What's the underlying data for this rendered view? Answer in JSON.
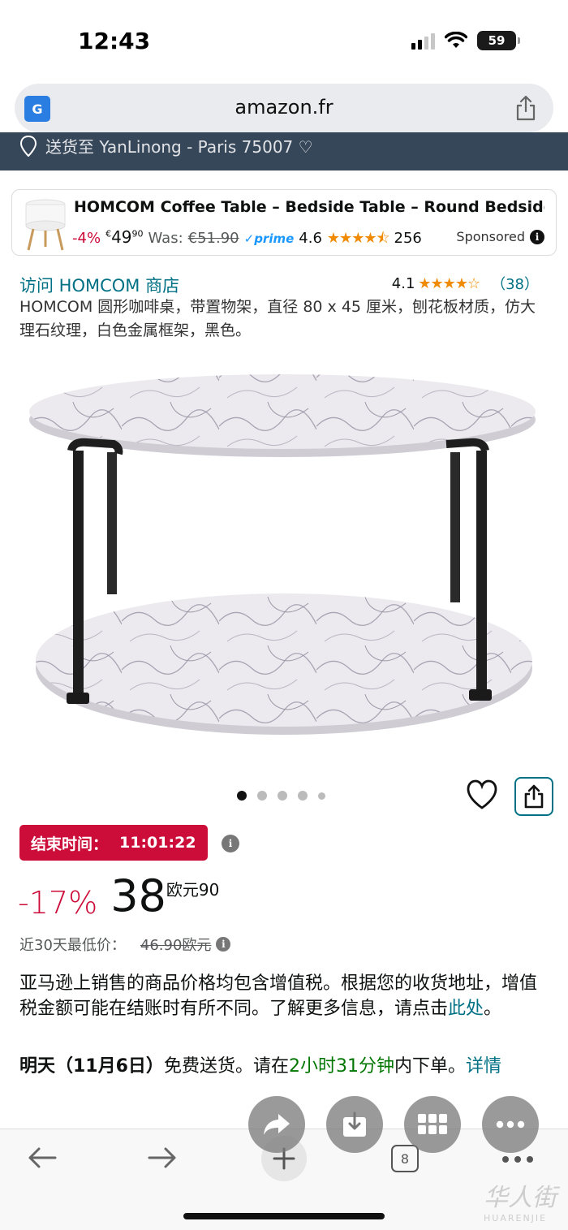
{
  "status_bar": {
    "time": "12:43",
    "battery": "59"
  },
  "browser": {
    "url": "amazon.fr"
  },
  "deliver_strip": {
    "text": "送货至 YanLinong - Paris 75007 ♡"
  },
  "sponsored_ad": {
    "title": "HOMCOM Coffee Table – Bedside Table – Round Bedside Table –...",
    "discount": "-4%",
    "price_currency": "€",
    "price_int": "49",
    "price_dec": "90",
    "was_label": "Was:",
    "was_price": "€51.90",
    "prime": "✓prime",
    "rating": "4.6",
    "stars": "★★★★⯪",
    "reviews": "256",
    "sponsored_label": "Sponsored"
  },
  "product": {
    "store_link": "访问 HOMCOM 商店",
    "rating": "4.1",
    "stars": "★★★★☆",
    "rating_count": "（38）",
    "title": "HOMCOM 圆形咖啡桌，带置物架，直径 80 x 45 厘米，刨花板材质，仿大理石纹理，白色金属框架，黑色。"
  },
  "deal": {
    "label": "结束时间：",
    "timer": "11:01:22"
  },
  "price": {
    "discount": "-17%",
    "integer": "38",
    "decimal": "欧元90",
    "lowest_label": "近30天最低价：",
    "lowest_price": "46.90欧元"
  },
  "vat": {
    "text": "亚马逊上销售的商品价格均包含增值税。根据您的收货地址，增值税金额可能在结账时有所不同。了解更多信息，请点击",
    "link": "此处",
    "end": "。"
  },
  "delivery": {
    "bold": "明天（11月6日）",
    "text1": "免费送货。请在",
    "green": "2小时31分钟",
    "text2": "内下单。",
    "link": "详情"
  },
  "toolbar": {
    "tabs_count": "8"
  },
  "watermark": {
    "main": "华人街",
    "sub": "HUARENJIE"
  }
}
